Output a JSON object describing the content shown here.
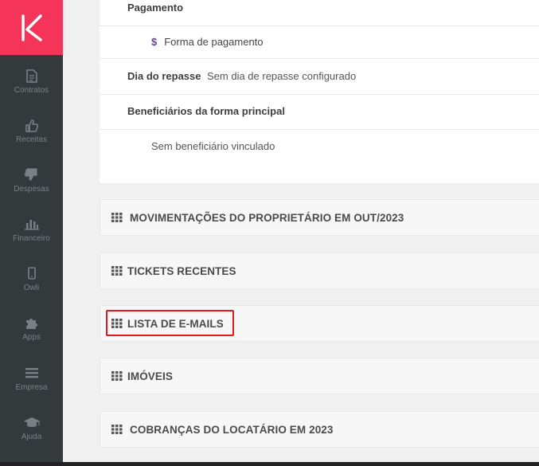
{
  "sidebar": {
    "items": [
      {
        "label": "Contratos",
        "icon": "document-icon"
      },
      {
        "label": "Receitas",
        "icon": "thumbs-up-icon"
      },
      {
        "label": "Despesas",
        "icon": "thumbs-down-icon"
      },
      {
        "label": "Financeiro",
        "icon": "bar-chart-icon"
      },
      {
        "label": "Owli",
        "icon": "phone-icon"
      },
      {
        "label": "Apps",
        "icon": "puzzle-icon"
      },
      {
        "label": "Empresa",
        "icon": "menu-icon"
      },
      {
        "label": "Ajuda",
        "icon": "graduation-cap-icon"
      }
    ]
  },
  "details": {
    "payment_label": "Pagamento",
    "payment_method_symbol": "$",
    "payment_method_label": "Forma de pagamento",
    "transfer_day_label": "Dia do repasse",
    "transfer_day_value": "Sem dia de repasse configurado",
    "beneficiaries_label": "Beneficiários da forma principal",
    "beneficiaries_value": "Sem beneficiário vinculado"
  },
  "sections": [
    {
      "title": "MOVIMENTAÇÕES DO PROPRIETÁRIO EM OUT/2023"
    },
    {
      "title": "TICKETS RECENTES"
    },
    {
      "title": "LISTA DE E-MAILS"
    },
    {
      "title": "IMÓVEIS"
    },
    {
      "title": "COBRANÇAS DO LOCATÁRIO EM 2023"
    }
  ],
  "colors": {
    "brand": "#f5345a",
    "sidebar_bg": "#34393c",
    "highlight": "#e01b1b",
    "accent_purple": "#6b3fa0"
  }
}
